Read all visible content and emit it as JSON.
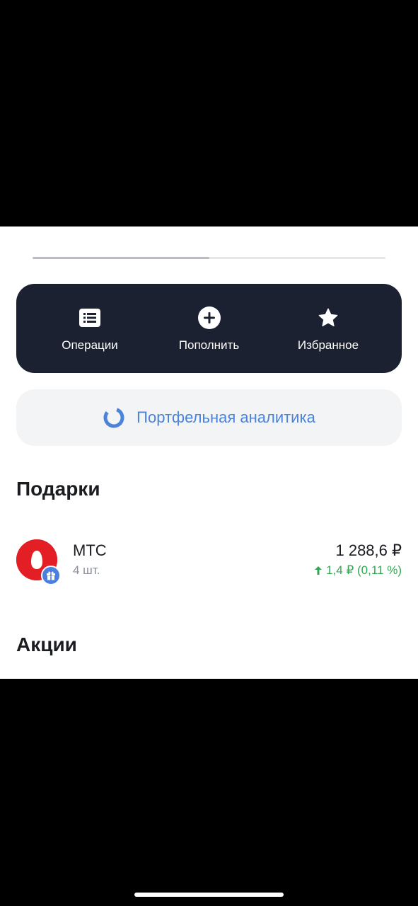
{
  "progress": {
    "fraction": 0.5
  },
  "actions": [
    {
      "label": "Операции",
      "icon": "list-icon"
    },
    {
      "label": "Пополнить",
      "icon": "plus-circle-icon"
    },
    {
      "label": "Избранное",
      "icon": "star-icon"
    }
  ],
  "analytics": {
    "label": "Портфельная аналитика",
    "icon": "donut-chart-icon",
    "color": "#4a83d9"
  },
  "sections": {
    "gifts": {
      "title": "Подарки",
      "items": [
        {
          "name": "МТС",
          "quantity": "4 шт.",
          "price": "1 288,6 ₽",
          "change": "1,4 ₽ (0,11 %)",
          "change_direction": "up",
          "logo_color": "#e31e24",
          "badge_icon": "gift-icon"
        }
      ]
    },
    "stocks": {
      "title": "Акции"
    }
  },
  "colors": {
    "action_bar_bg": "#1c2131",
    "positive": "#33a853",
    "accent": "#4a83d9"
  }
}
